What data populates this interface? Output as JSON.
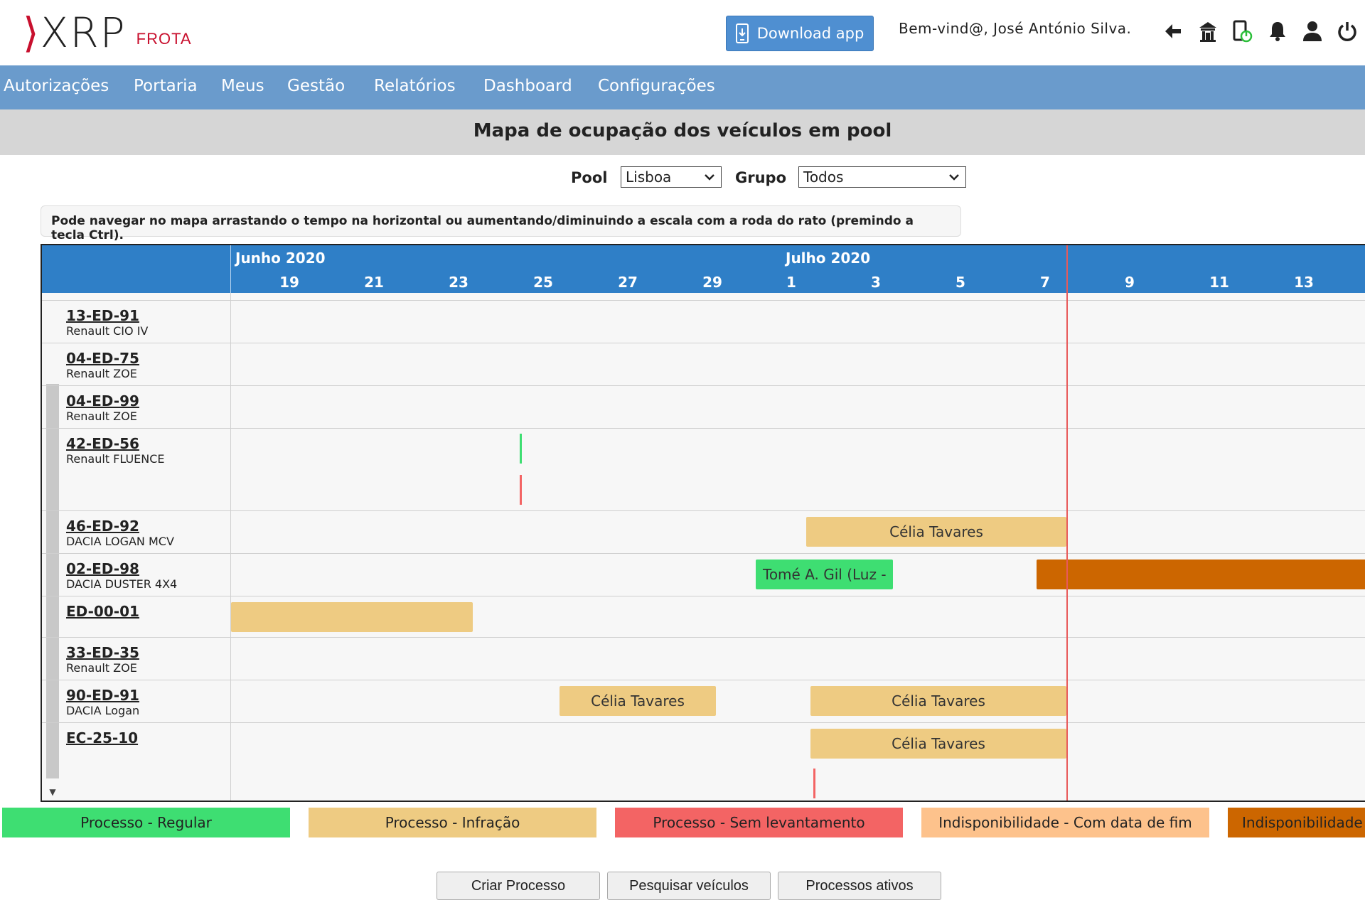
{
  "header": {
    "logo_text": "XRP",
    "logo_sub": "FROTA",
    "download_label": "Download app",
    "welcome": "Bem-vind@, José António Silva.",
    "icons": [
      "back-arrow-icon",
      "home-icon",
      "device-power-icon",
      "bell-icon",
      "user-icon",
      "power-icon"
    ]
  },
  "nav": {
    "items": [
      "Autorizações",
      "Portaria",
      "Meus",
      "Gestão",
      "Relatórios",
      "Dashboard",
      "Configurações"
    ]
  },
  "page_title": "Mapa de ocupação dos veículos em pool",
  "filters": {
    "pool_label": "Pool",
    "pool_value": "Lisboa",
    "group_label": "Grupo",
    "group_value": "Todos"
  },
  "hint": "Pode navegar no mapa arrastando o tempo na horizontal ou aumentando/diminuindo a escala com a roda do rato (premindo a tecla Ctrl).",
  "timeline": {
    "months": [
      "Junho 2020",
      "Julho 2020"
    ],
    "days": [
      "19",
      "21",
      "23",
      "25",
      "27",
      "29",
      "1",
      "3",
      "5",
      "7",
      "9",
      "11",
      "13"
    ]
  },
  "vehicles": [
    {
      "plate": "13-ED-91",
      "model": "Renault CIO IV"
    },
    {
      "plate": "04-ED-75",
      "model": "Renault ZOE"
    },
    {
      "plate": "04-ED-99",
      "model": "Renault ZOE"
    },
    {
      "plate": "42-ED-56",
      "model": "Renault FLUENCE"
    },
    {
      "plate": "46-ED-92",
      "model": "DACIA LOGAN MCV"
    },
    {
      "plate": "02-ED-98",
      "model": "DACIA DUSTER 4X4"
    },
    {
      "plate": "ED-00-01",
      "model": ""
    },
    {
      "plate": "33-ED-35",
      "model": "Renault ZOE"
    },
    {
      "plate": "90-ED-91",
      "model": "DACIA Logan"
    },
    {
      "plate": "EC-25-10",
      "model": ""
    }
  ],
  "bookings": {
    "b46": "Célia Tavares",
    "b02": "Tomé A. Gil (Luz -",
    "b90a": "Célia Tavares",
    "b90b": "Célia Tavares",
    "bEC": "Célia Tavares"
  },
  "legend": [
    {
      "label": "Processo - Regular",
      "color": "#3ede72"
    },
    {
      "label": "Processo - Infração",
      "color": "#eecb82"
    },
    {
      "label": "Processo - Sem levantamento",
      "color": "#f36464"
    },
    {
      "label": "Indisponibilidade - Com data de fim",
      "color": "#fdc28c"
    },
    {
      "label": "Indisponibilidade",
      "color": "#cc6600"
    }
  ],
  "buttons": {
    "create": "Criar Processo",
    "search": "Pesquisar veículos",
    "active": "Processos ativos"
  }
}
